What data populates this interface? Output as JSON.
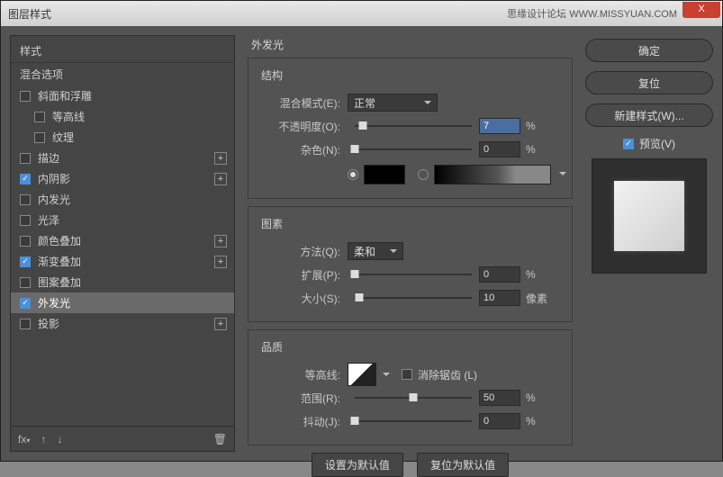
{
  "titlebar": {
    "title": "图层样式",
    "forum": "思缘设计论坛  WWW.MISSYUAN.COM",
    "close": "X"
  },
  "left": {
    "header": "样式",
    "subheader": "混合选项",
    "items": [
      {
        "label": "斜面和浮雕",
        "checked": false,
        "has_plus": false
      },
      {
        "label": "等高线",
        "checked": false,
        "has_plus": false
      },
      {
        "label": "纹理",
        "checked": false,
        "has_plus": false
      },
      {
        "label": "描边",
        "checked": false,
        "has_plus": true
      },
      {
        "label": "内阴影",
        "checked": true,
        "has_plus": true
      },
      {
        "label": "内发光",
        "checked": false,
        "has_plus": false
      },
      {
        "label": "光泽",
        "checked": false,
        "has_plus": false
      },
      {
        "label": "颜色叠加",
        "checked": false,
        "has_plus": true
      },
      {
        "label": "渐变叠加",
        "checked": true,
        "has_plus": true
      },
      {
        "label": "图案叠加",
        "checked": false,
        "has_plus": false
      },
      {
        "label": "外发光",
        "checked": true,
        "has_plus": false,
        "selected": true
      },
      {
        "label": "投影",
        "checked": false,
        "has_plus": true
      }
    ],
    "footer_fx": "fx",
    "footer_trash": "🗑"
  },
  "middle": {
    "title": "外发光",
    "structure": {
      "title": "结构",
      "blend_label": "混合模式(E):",
      "blend_value": "正常",
      "opacity_label": "不透明度(O):",
      "opacity_value": "7",
      "opacity_unit": "%",
      "noise_label": "杂色(N):",
      "noise_value": "0",
      "noise_unit": "%"
    },
    "elements": {
      "title": "图素",
      "method_label": "方法(Q):",
      "method_value": "柔和",
      "spread_label": "扩展(P):",
      "spread_value": "0",
      "spread_unit": "%",
      "size_label": "大小(S):",
      "size_value": "10",
      "size_unit": "像素"
    },
    "quality": {
      "title": "品质",
      "contour_label": "等高线:",
      "antialias_label": "消除锯齿 (L)",
      "range_label": "范围(R):",
      "range_value": "50",
      "range_unit": "%",
      "jitter_label": "抖动(J):",
      "jitter_value": "0",
      "jitter_unit": "%"
    },
    "buttons": {
      "default": "设置为默认值",
      "reset": "复位为默认值"
    }
  },
  "right": {
    "ok": "确定",
    "cancel": "复位",
    "new_style": "新建样式(W)...",
    "preview_label": "预览(V)"
  }
}
